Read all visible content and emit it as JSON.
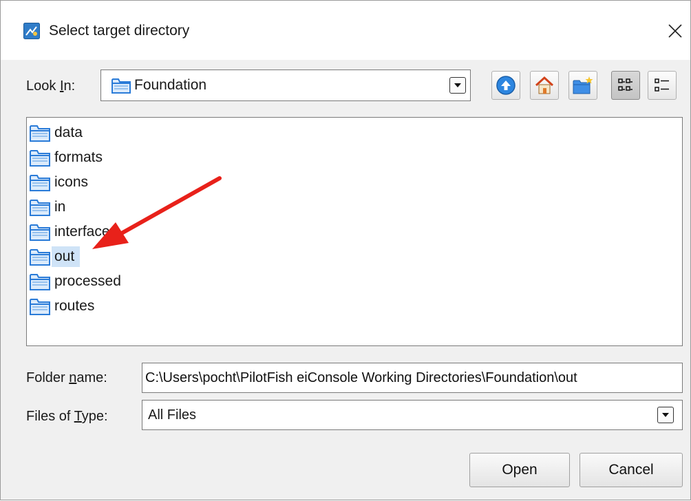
{
  "window": {
    "title": "Select target directory",
    "close_glyph": "✕",
    "app_icon": "java-app-icon"
  },
  "look_in": {
    "label_pre": "Look ",
    "label_mnemonic": "I",
    "label_post": "n:",
    "value": "Foundation"
  },
  "toolbar": {
    "buttons": [
      "up-one-level-icon",
      "home-icon",
      "new-folder-icon",
      "list-view-icon",
      "details-view-icon"
    ],
    "active": "list-view-icon"
  },
  "files": [
    {
      "name": "data",
      "selected": false
    },
    {
      "name": "formats",
      "selected": false
    },
    {
      "name": "icons",
      "selected": false
    },
    {
      "name": "in",
      "selected": false
    },
    {
      "name": "interfaces",
      "selected": false
    },
    {
      "name": "out",
      "selected": true
    },
    {
      "name": "processed",
      "selected": false
    },
    {
      "name": "routes",
      "selected": false
    }
  ],
  "folder_name": {
    "label_pre": "Folder ",
    "label_mnemonic": "n",
    "label_post": "ame:",
    "value": "C:\\Users\\pocht\\PilotFish eiConsole Working Directories\\Foundation\\out"
  },
  "files_of_type": {
    "label_pre": "Files of ",
    "label_mnemonic": "T",
    "label_post": "ype:",
    "value": "All Files"
  },
  "buttons": {
    "open": "Open",
    "cancel": "Cancel"
  },
  "colors": {
    "dialog_bg": "#f0f0f0",
    "selection": "#cfe3f7",
    "annotation_arrow": "#e8211a",
    "folder_icon": "#2a7bd8"
  }
}
